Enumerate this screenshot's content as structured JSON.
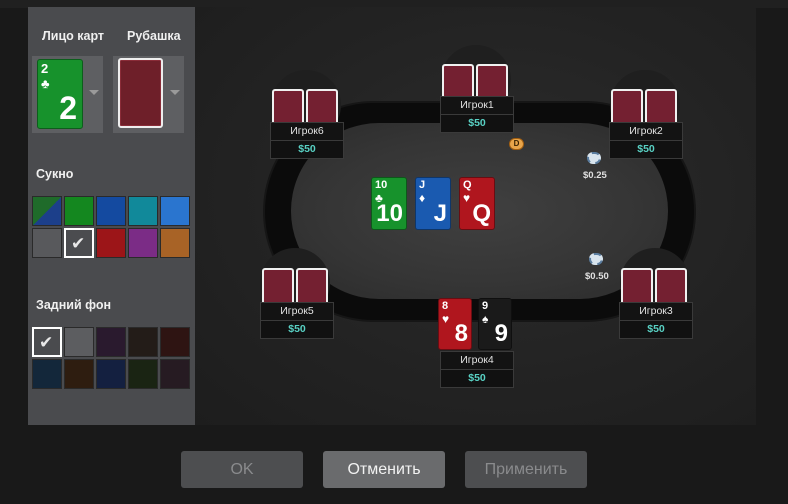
{
  "sidebar": {
    "face_label": "Лицо карт",
    "back_label": "Рубашка",
    "face_preview": {
      "rank": "2",
      "suit": "♣",
      "color": "#17922c"
    },
    "cloth_label": "Сукно",
    "cloth_colors": [
      "#1e4e2a",
      "#14871f",
      "#144aa0",
      "#11899a",
      "#2a75cf",
      "#58595c",
      "#4b4c4f",
      "#9c1518",
      "#7b2c86",
      "#a86326"
    ],
    "background_label": "Задний фон",
    "background_colors": [
      "#4a4b4e",
      "#5c5d60",
      "#2a1a2e",
      "#231c18",
      "#2e1412",
      "#13273a",
      "#2e1d10",
      "#142040",
      "#1a2413",
      "#261b22"
    ],
    "check_icon": "✔"
  },
  "table": {
    "players": [
      {
        "name": "Игрок1",
        "stack": "$50"
      },
      {
        "name": "Игрок2",
        "stack": "$50"
      },
      {
        "name": "Игрок3",
        "stack": "$50"
      },
      {
        "name": "Игрок4",
        "stack": "$50"
      },
      {
        "name": "Игрок5",
        "stack": "$50"
      },
      {
        "name": "Игрок6",
        "stack": "$50"
      }
    ],
    "board": [
      {
        "rank": "10",
        "suit": "♣",
        "color": "#17922c"
      },
      {
        "rank": "J",
        "suit": "♦",
        "color": "#1a5ab0"
      },
      {
        "rank": "Q",
        "suit": "♥",
        "color": "#b0161e"
      }
    ],
    "hero_cards": [
      {
        "rank": "8",
        "suit": "♥",
        "color": "#b0161e"
      },
      {
        "rank": "9",
        "suit": "♠",
        "color": "#1a1a1a"
      }
    ],
    "dealer_button": "D",
    "bets": [
      {
        "amount": "$0.25"
      },
      {
        "amount": "$0.50"
      }
    ]
  },
  "buttons": {
    "ok": "OK",
    "cancel": "Отменить",
    "apply": "Применить"
  }
}
